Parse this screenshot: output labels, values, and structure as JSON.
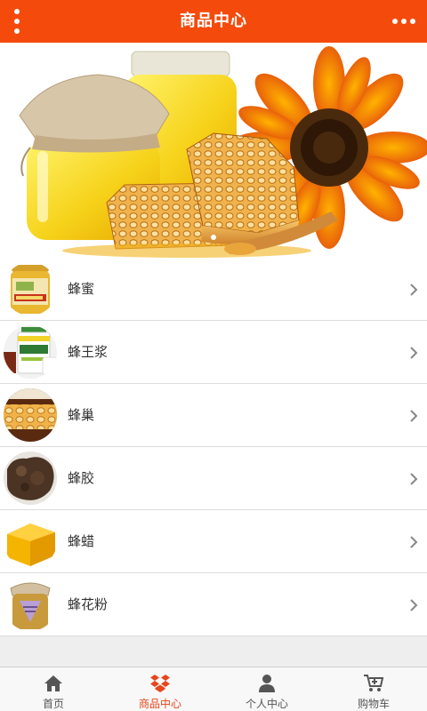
{
  "header": {
    "title": "商品中心",
    "menu_icon": "vertical-dots-icon",
    "more_icon": "horizontal-dots-icon",
    "background": "#f44b0d"
  },
  "banner": {
    "image": "honey-jars-honeycomb-sunflower",
    "slide_count": 1,
    "active_slide": 1
  },
  "categories": [
    {
      "label": "蜂蜜",
      "thumb": "honey-bottle-photo"
    },
    {
      "label": "蜂王浆",
      "thumb": "royal-jelly-jar-photo"
    },
    {
      "label": "蜂巢",
      "thumb": "honeycomb-photo"
    },
    {
      "label": "蜂胶",
      "thumb": "propolis-photo"
    },
    {
      "label": "蜂蜡",
      "thumb": "beeswax-photo"
    },
    {
      "label": "蜂花粉",
      "thumb": "bee-pollen-jar-photo"
    }
  ],
  "footer": {
    "active_color": "#e5461b",
    "tabs": [
      {
        "label": "首页",
        "icon": "home-icon",
        "active": false
      },
      {
        "label": "商品中心",
        "icon": "dropbox-icon",
        "active": true
      },
      {
        "label": "个人中心",
        "icon": "user-icon",
        "active": false
      },
      {
        "label": "购物车",
        "icon": "cart-icon",
        "active": false
      }
    ]
  }
}
